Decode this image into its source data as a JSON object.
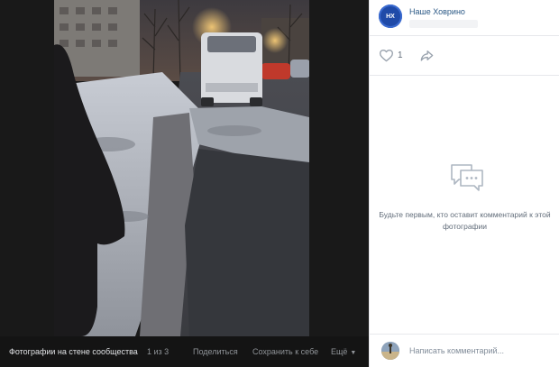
{
  "viewer": {
    "album_title": "Фотографии на стене сообщества",
    "counter": "1 из 3",
    "share_label": "Поделиться",
    "save_label": "Сохранить к себе",
    "more_label": "Ещё"
  },
  "author": {
    "name": "Наше Ховрино",
    "avatar_initials": "НХ"
  },
  "actions": {
    "likes": "1"
  },
  "comments": {
    "empty_text": "Будьте первым, кто оставит комментарий к этой фотографии",
    "input_placeholder": "Написать комментарий..."
  },
  "colors": {
    "accent": "#2a5885",
    "viewer_bg": "#191919",
    "sidebar_bg": "#ffffff",
    "avatar_bg": "#1f4aa8"
  },
  "icons": {
    "like": "heart-icon",
    "share": "share-arrow-icon",
    "empty_comments": "chat-bubbles-icon",
    "more": "chevron-down-icon"
  }
}
